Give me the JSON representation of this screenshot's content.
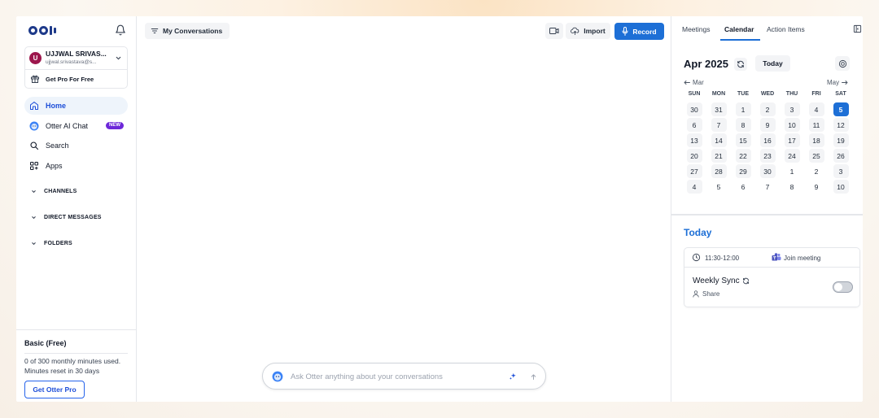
{
  "sidebar": {
    "account": {
      "avatar_initial": "U",
      "name": "UJJWAL SRIVAS...",
      "email": "ujjwal.srivastava@s...",
      "pro_label": "Get Pro For Free"
    },
    "nav": [
      {
        "label": "Home",
        "icon": "home-icon",
        "active": true
      },
      {
        "label": "Otter AI Chat",
        "icon": "otter-chat-icon",
        "badge": "NEW"
      },
      {
        "label": "Search",
        "icon": "search-icon"
      },
      {
        "label": "Apps",
        "icon": "apps-icon"
      }
    ],
    "sections": [
      "CHANNELS",
      "DIRECT MESSAGES",
      "FOLDERS"
    ],
    "plan": {
      "title": "Basic (Free)",
      "usage": "0 of 300 monthly minutes used.",
      "reset": "Minutes reset in 30 days",
      "button": "Get Otter Pro"
    }
  },
  "main": {
    "filter_label": "My Conversations",
    "import_label": "Import",
    "record_label": "Record",
    "ask_placeholder": "Ask Otter anything about your conversations"
  },
  "right": {
    "tabs": [
      "Meetings",
      "Calendar",
      "Action Items"
    ],
    "active_tab": "Calendar",
    "calendar": {
      "month_label": "Apr 2025",
      "today_label": "Today",
      "prev_label": "Mar",
      "next_label": "May",
      "weekdays": [
        "SUN",
        "MON",
        "TUE",
        "WED",
        "THU",
        "FRI",
        "SAT"
      ],
      "weeks": [
        [
          "30",
          "31",
          "1",
          "2",
          "3",
          "4",
          "5"
        ],
        [
          "6",
          "7",
          "8",
          "9",
          "10",
          "11",
          "12"
        ],
        [
          "13",
          "14",
          "15",
          "16",
          "17",
          "18",
          "19"
        ],
        [
          "20",
          "21",
          "22",
          "23",
          "24",
          "25",
          "26"
        ],
        [
          "27",
          "28",
          "29",
          "30",
          "1",
          "2",
          "3"
        ],
        [
          "4",
          "5",
          "6",
          "7",
          "8",
          "9",
          "10"
        ]
      ],
      "selected": "5",
      "accent_color": "#1d6fd6"
    },
    "today": {
      "title": "Today",
      "event": {
        "time": "11:30-12:00",
        "join_label": "Join meeting",
        "name": "Weekly Sync",
        "share_label": "Share",
        "toggle_on": false
      }
    }
  }
}
